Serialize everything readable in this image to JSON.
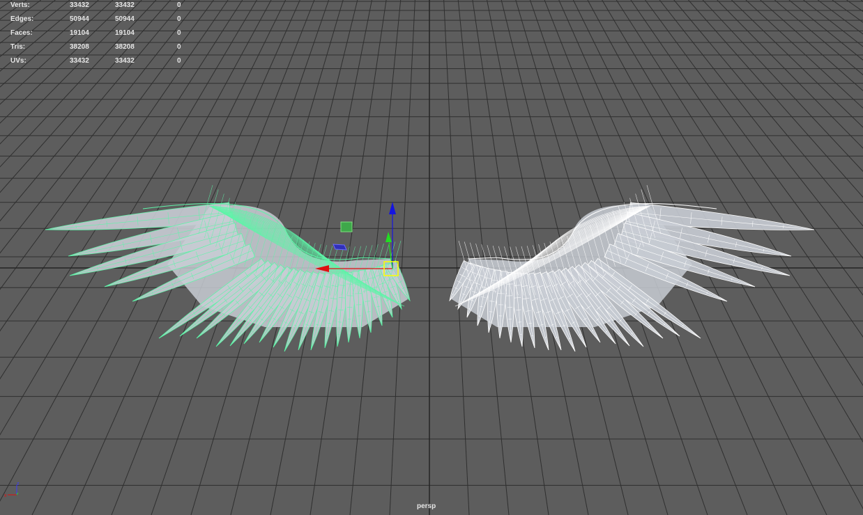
{
  "stats": [
    {
      "label": "Verts:",
      "total": "33432",
      "selected": "33432",
      "third": "0"
    },
    {
      "label": "Edges:",
      "total": "50944",
      "selected": "50944",
      "third": "0"
    },
    {
      "label": "Faces:",
      "total": "19104",
      "selected": "19104",
      "third": "0"
    },
    {
      "label": "Tris:",
      "total": "38208",
      "selected": "38208",
      "third": "0"
    },
    {
      "label": "UVs:",
      "total": "33432",
      "selected": "33432",
      "third": "0"
    }
  ],
  "camera": "persp",
  "axis_indicator": {
    "z": "z",
    "x": "x"
  },
  "colors": {
    "background": "#5d5d5d",
    "grid": "#2f2f2f",
    "selected_wireframe": "#5ef5a8",
    "unselected_wireframe": "#ffffff",
    "wing_surface": "#c8ccd4",
    "manip_x": "#e01010",
    "manip_y": "#22dd22",
    "manip_z": "#1515e0",
    "manip_center": "#ffff00"
  },
  "objects": [
    {
      "name": "left-wing",
      "state": "selected"
    },
    {
      "name": "right-wing",
      "state": "unselected"
    }
  ],
  "manipulator": {
    "type": "move-tool"
  }
}
